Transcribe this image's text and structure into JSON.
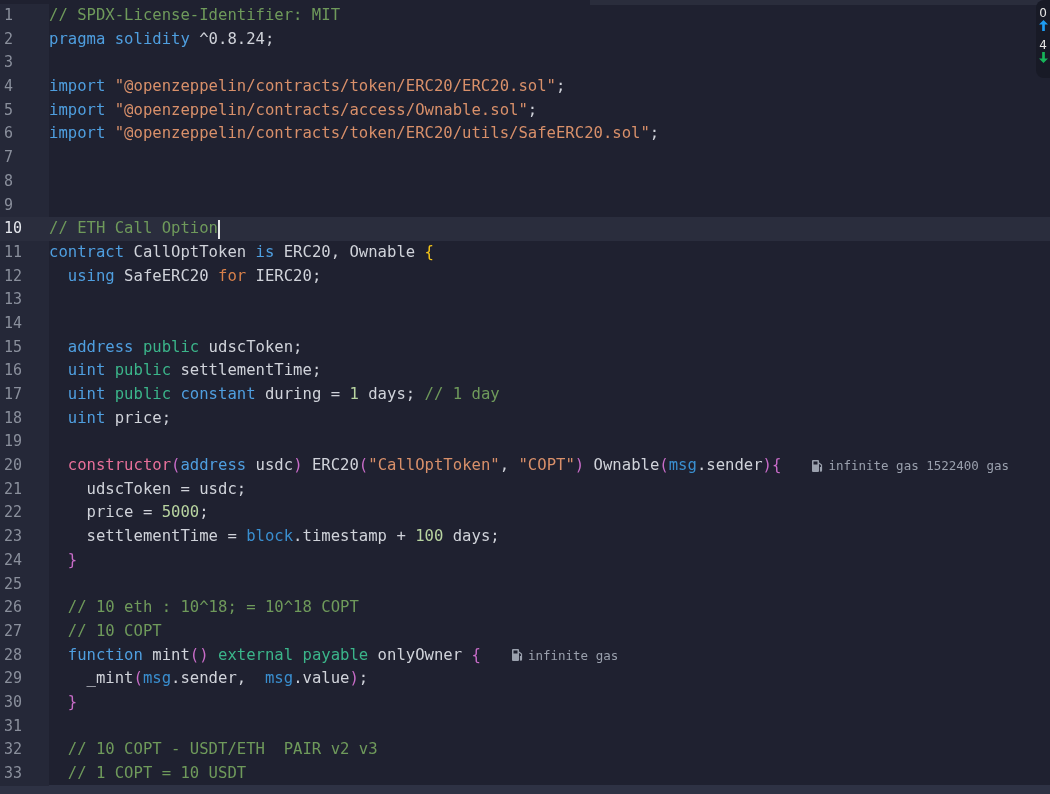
{
  "editor": {
    "lines": [
      {
        "n": "1",
        "current": false,
        "tokens": [
          {
            "text": "// SPDX-License-Identifier: MIT",
            "kind": "comment"
          }
        ]
      },
      {
        "n": "2",
        "current": false,
        "tokens": [
          {
            "text": "pragma ",
            "kind": "keyword"
          },
          {
            "text": "solidity ",
            "kind": "keyword"
          },
          {
            "text": "^0.8.24;",
            "kind": "plain"
          }
        ]
      },
      {
        "n": "3",
        "current": false
      },
      {
        "n": "4",
        "current": false,
        "tokens": [
          {
            "text": "import ",
            "kind": "keyword"
          },
          {
            "text": "\"@openzeppelin/contracts/token/ERC20/ERC20.sol\"",
            "kind": "string"
          },
          {
            "text": ";",
            "kind": "plain"
          }
        ]
      },
      {
        "n": "5",
        "current": false,
        "tokens": [
          {
            "text": "import ",
            "kind": "keyword"
          },
          {
            "text": "\"@openzeppelin/contracts/access/Ownable.sol\"",
            "kind": "string"
          },
          {
            "text": ";",
            "kind": "plain"
          }
        ]
      },
      {
        "n": "6",
        "current": false,
        "tokens": [
          {
            "text": "import ",
            "kind": "keyword"
          },
          {
            "text": "\"@openzeppelin/contracts/token/ERC20/utils/SafeERC20.sol\"",
            "kind": "string"
          },
          {
            "text": ";",
            "kind": "plain"
          }
        ]
      },
      {
        "n": "7",
        "current": false
      },
      {
        "n": "8",
        "current": false
      },
      {
        "n": "9",
        "current": false
      },
      {
        "n": "10",
        "current": true,
        "caret": true,
        "tokens": [
          {
            "text": "// ETH Call Option",
            "kind": "comment"
          }
        ]
      },
      {
        "n": "11",
        "current": false,
        "tokens": [
          {
            "text": "contract",
            "kind": "keyword"
          },
          {
            "text": " CallOptToken ",
            "kind": "plain"
          },
          {
            "text": "is",
            "kind": "keyword"
          },
          {
            "text": " ERC20, Ownable ",
            "kind": "plain"
          },
          {
            "text": "{",
            "kind": "brace"
          }
        ]
      },
      {
        "n": "12",
        "current": false,
        "tokens": [
          {
            "text": "  using",
            "kind": "keyword"
          },
          {
            "text": " SafeERC20 ",
            "kind": "plain"
          },
          {
            "text": "for",
            "kind": "control"
          },
          {
            "text": " IERC20;",
            "kind": "plain"
          }
        ]
      },
      {
        "n": "13",
        "current": false
      },
      {
        "n": "14",
        "current": false
      },
      {
        "n": "15",
        "current": false,
        "tokens": [
          {
            "text": "  address ",
            "kind": "keyword"
          },
          {
            "text": "public",
            "kind": "modifier"
          },
          {
            "text": " udscToken;",
            "kind": "plain"
          }
        ]
      },
      {
        "n": "16",
        "current": false,
        "tokens": [
          {
            "text": "  uint ",
            "kind": "keyword"
          },
          {
            "text": "public",
            "kind": "modifier"
          },
          {
            "text": " settlementTime;",
            "kind": "plain"
          }
        ]
      },
      {
        "n": "17",
        "current": false,
        "tokens": [
          {
            "text": "  uint ",
            "kind": "keyword"
          },
          {
            "text": "public ",
            "kind": "modifier"
          },
          {
            "text": "constant",
            "kind": "keyword"
          },
          {
            "text": " during = ",
            "kind": "plain"
          },
          {
            "text": "1",
            "kind": "number"
          },
          {
            "text": " days; ",
            "kind": "plain"
          },
          {
            "text": "// 1 day",
            "kind": "comment"
          }
        ]
      },
      {
        "n": "18",
        "current": false,
        "tokens": [
          {
            "text": "  uint",
            "kind": "keyword"
          },
          {
            "text": " price;",
            "kind": "plain"
          }
        ]
      },
      {
        "n": "19",
        "current": false
      },
      {
        "n": "20",
        "current": false,
        "hint": "infinite gas 1522400 gas",
        "tokens": [
          {
            "text": "  constructor",
            "kind": "function"
          },
          {
            "text": "(",
            "kind": "paren"
          },
          {
            "text": "address",
            "kind": "keyword"
          },
          {
            "text": " usdc",
            "kind": "plain"
          },
          {
            "text": ")",
            "kind": "paren"
          },
          {
            "text": " ERC20",
            "kind": "plain"
          },
          {
            "text": "(",
            "kind": "paren"
          },
          {
            "text": "\"CallOptToken\"",
            "kind": "string"
          },
          {
            "text": ", ",
            "kind": "plain"
          },
          {
            "text": "\"COPT\"",
            "kind": "string"
          },
          {
            "text": ")",
            "kind": "paren"
          },
          {
            "text": " Ownable",
            "kind": "plain"
          },
          {
            "text": "(",
            "kind": "paren"
          },
          {
            "text": "msg",
            "kind": "builtin"
          },
          {
            "text": ".sender",
            "kind": "plain"
          },
          {
            "text": "){",
            "kind": "paren"
          }
        ]
      },
      {
        "n": "21",
        "current": false,
        "tokens": [
          {
            "text": "    udscToken = usdc;",
            "kind": "plain"
          }
        ]
      },
      {
        "n": "22",
        "current": false,
        "tokens": [
          {
            "text": "    price = ",
            "kind": "plain"
          },
          {
            "text": "5000",
            "kind": "number"
          },
          {
            "text": ";",
            "kind": "plain"
          }
        ]
      },
      {
        "n": "23",
        "current": false,
        "tokens": [
          {
            "text": "    settlementTime = ",
            "kind": "plain"
          },
          {
            "text": "block",
            "kind": "builtin"
          },
          {
            "text": ".timestamp + ",
            "kind": "plain"
          },
          {
            "text": "100",
            "kind": "number"
          },
          {
            "text": " days;",
            "kind": "plain"
          }
        ]
      },
      {
        "n": "24",
        "current": false,
        "tokens": [
          {
            "text": "  }",
            "kind": "paren"
          }
        ]
      },
      {
        "n": "25",
        "current": false
      },
      {
        "n": "26",
        "current": false,
        "tokens": [
          {
            "text": "  // 10 eth : 10^18; = 10^18 COPT",
            "kind": "comment"
          }
        ]
      },
      {
        "n": "27",
        "current": false,
        "tokens": [
          {
            "text": "  // 10 COPT",
            "kind": "comment"
          }
        ]
      },
      {
        "n": "28",
        "current": false,
        "hint": "infinite gas",
        "tokens": [
          {
            "text": "  function",
            "kind": "keyword"
          },
          {
            "text": " mint",
            "kind": "plain"
          },
          {
            "text": "()",
            "kind": "paren"
          },
          {
            "text": " external payable",
            "kind": "modifier"
          },
          {
            "text": " onlyOwner ",
            "kind": "plain"
          },
          {
            "text": "{",
            "kind": "paren"
          }
        ]
      },
      {
        "n": "29",
        "current": false,
        "tokens": [
          {
            "text": "    _mint",
            "kind": "plain"
          },
          {
            "text": "(",
            "kind": "paren"
          },
          {
            "text": "msg",
            "kind": "builtin"
          },
          {
            "text": ".sender,  ",
            "kind": "plain"
          },
          {
            "text": "msg",
            "kind": "builtin"
          },
          {
            "text": ".value",
            "kind": "plain"
          },
          {
            "text": ")",
            "kind": "paren"
          },
          {
            "text": ";",
            "kind": "plain"
          }
        ]
      },
      {
        "n": "30",
        "current": false,
        "tokens": [
          {
            "text": "  }",
            "kind": "paren"
          }
        ]
      },
      {
        "n": "31",
        "current": false
      },
      {
        "n": "32",
        "current": false,
        "tokens": [
          {
            "text": "  // 10 COPT - USDT/ETH  PAIR v2 v3",
            "kind": "comment"
          }
        ]
      },
      {
        "n": "33",
        "current": false,
        "tokens": [
          {
            "text": "  // 1 COPT = 10 USDT",
            "kind": "comment"
          }
        ]
      }
    ]
  },
  "sync_panel": {
    "items": [
      {
        "count": "0",
        "kind": "up"
      },
      {
        "count": "4",
        "kind": "down"
      }
    ]
  }
}
